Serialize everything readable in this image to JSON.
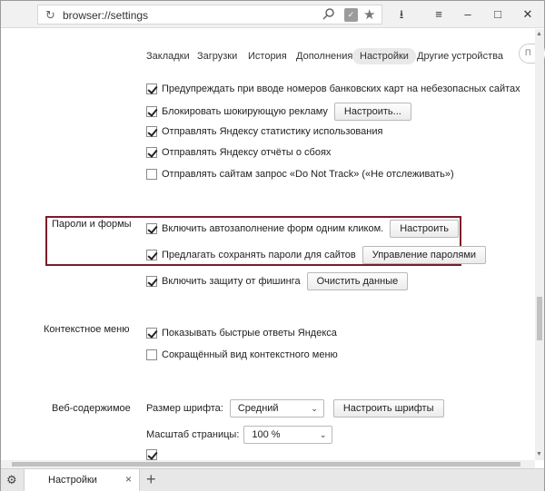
{
  "address_bar": {
    "url": "browser://settings",
    "reload_icon": "reload-icon",
    "search_icon": "search-icon",
    "shield_icon": "shield-icon",
    "star_icon": "star-icon"
  },
  "window_controls": {
    "download_icon": "download-icon",
    "menu_icon": "hamburger-icon",
    "minimize": "minimize-icon",
    "maximize": "maximize-icon",
    "close": "close-icon"
  },
  "nav": {
    "items": [
      "Закладки",
      "Загрузки",
      "История",
      "Дополнения",
      "Настройки",
      "Другие устройства"
    ],
    "active": "Настройки",
    "search_stub": "П"
  },
  "privacy": {
    "items": [
      {
        "label": "Предупреждать при вводе номеров банковских карт на небезопасных сайтах",
        "checked": true
      },
      {
        "label": "Блокировать шокирующую рекламу",
        "checked": true,
        "button": "Настроить..."
      },
      {
        "label": "Отправлять Яндексу статистику использования",
        "checked": true
      },
      {
        "label": "Отправлять Яндексу отчёты о сбоях",
        "checked": true
      },
      {
        "label": "Отправлять сайтам запрос «Do Not Track» («Не отслеживать»)",
        "checked": false
      }
    ]
  },
  "passwords": {
    "section_title": "Пароли и формы",
    "autofill": {
      "label": "Включить автозаполнение форм одним кликом.",
      "checked": true,
      "button": "Настроить"
    },
    "save_passwords": {
      "label": "Предлагать сохранять пароли для сайтов",
      "checked": true,
      "button": "Управление паролями"
    },
    "phishing": {
      "label": "Включить защиту от фишинга",
      "checked": true,
      "button": "Очистить данные"
    }
  },
  "context_menu": {
    "section_title": "Контекстное меню",
    "quick_answers": {
      "label": "Показывать быстрые ответы Яндекса",
      "checked": true
    },
    "compact": {
      "label": "Сокращённый вид контекстного меню",
      "checked": false
    }
  },
  "web_content": {
    "section_title": "Веб-содержимое",
    "font_size_label": "Размер шрифта:",
    "font_size_value": "Средний",
    "font_button": "Настроить шрифты",
    "zoom_label": "Масштаб страницы:",
    "zoom_value": "100 %"
  },
  "tabs": {
    "active_title": "Настройки",
    "close": "×",
    "new_tab": "+"
  },
  "colors": {
    "highlight_border": "#7a1c2a",
    "active_nav_bg": "#e9e9e9"
  }
}
